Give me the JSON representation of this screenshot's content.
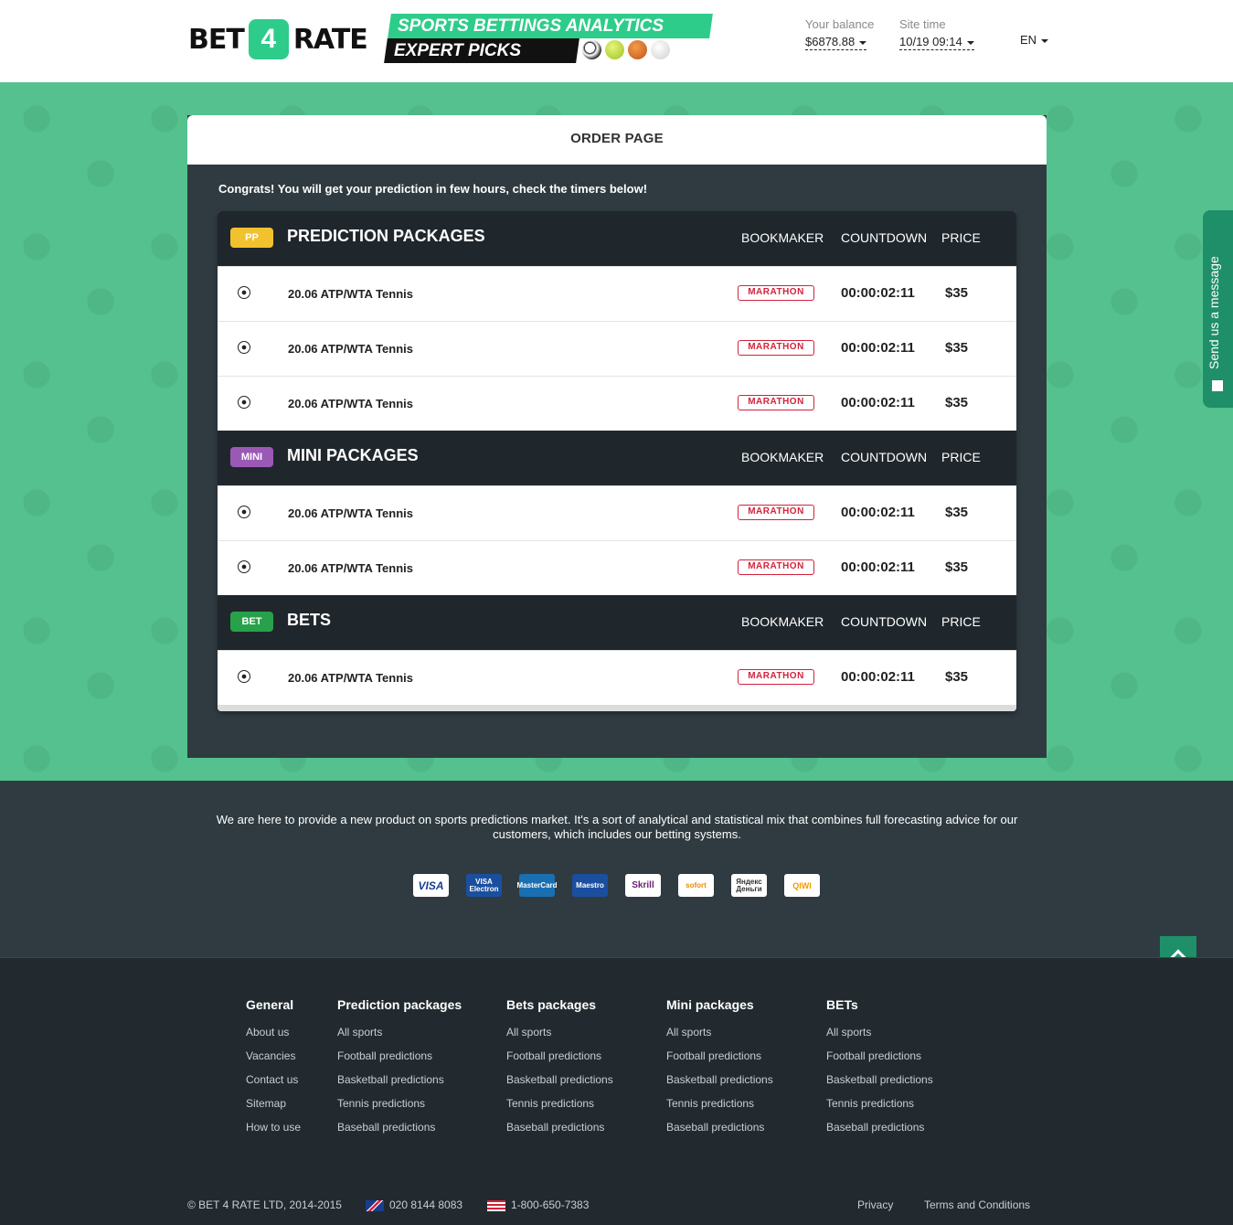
{
  "header": {
    "logo_left": "BET",
    "logo_mid": "4",
    "logo_right": "RATE",
    "tagline1": "SPORTS BETTINGS ANALYTICS",
    "tagline2": "EXPERT PICKS",
    "balance_label": "Your balance",
    "balance_value": "$6878.88",
    "time_label": "Site time",
    "time_value": "10/19 09:14",
    "lang": "EN"
  },
  "page": {
    "title": "ORDER PAGE",
    "congrats": "Congrats! You will get your prediction in few hours, check the timers below!"
  },
  "columns": {
    "bookmaker": "BOOKMAKER",
    "countdown": "COUNTDOWN",
    "price": "PRICE"
  },
  "bookmaker_logo": "MARATHON",
  "sections": [
    {
      "badge": "PP",
      "title": "PREDICTION PACKAGES",
      "rows": [
        {
          "name": "20.06 ATP/WTA Tennis",
          "countdown": "00:00:02:11",
          "price": "$35"
        },
        {
          "name": "20.06 ATP/WTA Tennis",
          "countdown": "00:00:02:11",
          "price": "$35"
        },
        {
          "name": "20.06 ATP/WTA Tennis",
          "countdown": "00:00:02:11",
          "price": "$35"
        }
      ]
    },
    {
      "badge": "MINI",
      "title": "MINI PACKAGES",
      "rows": [
        {
          "name": "20.06 ATP/WTA Tennis",
          "countdown": "00:00:02:11",
          "price": "$35"
        },
        {
          "name": "20.06 ATP/WTA Tennis",
          "countdown": "00:00:02:11",
          "price": "$35"
        }
      ]
    },
    {
      "badge": "BET",
      "title": "BETS",
      "rows": [
        {
          "name": "20.06 ATP/WTA Tennis",
          "countdown": "00:00:02:11",
          "price": "$35"
        }
      ]
    }
  ],
  "message_tab": "Send us a message",
  "footer": {
    "about": "We are here to provide a new product on sports predictions market. It's a sort of analytical and statistical mix that combines full forecasting advice for our customers, which includes our betting systems.",
    "payments": [
      "VISA",
      "VISA Electron",
      "MasterCard",
      "Maestro",
      "Skrill",
      "sofort",
      "Яндекс Деньги",
      "QIWI"
    ],
    "columns": [
      {
        "heading": "General",
        "links": [
          "About us",
          "Vacancies",
          "Contact us",
          "Sitemap",
          "How to use"
        ]
      },
      {
        "heading": "Prediction packages",
        "links": [
          "All sports",
          "Football predictions",
          "Basketball predictions",
          "Tennis predictions",
          "Baseball predictions"
        ]
      },
      {
        "heading": "Bets packages",
        "links": [
          "All sports",
          "Football predictions",
          "Basketball predictions",
          "Tennis predictions",
          "Baseball predictions"
        ]
      },
      {
        "heading": "Mini packages",
        "links": [
          "All sports",
          "Football predictions",
          "Basketball predictions",
          "Tennis predictions",
          "Baseball predictions"
        ]
      },
      {
        "heading": "BETs",
        "links": [
          "All sports",
          "Football predictions",
          "Basketball predictions",
          "Tennis predictions",
          "Baseball predictions"
        ]
      }
    ],
    "copyright": "© BET 4 RATE LTD, 2014-2015",
    "phone_uk": "020 8144 8083",
    "phone_us": "1-800-650-7383",
    "privacy": "Privacy",
    "terms": "Terms and Conditions"
  },
  "colors": {
    "accent": "#2ecc8b",
    "dark": "#20272c",
    "band": "#54c18e",
    "bookmaker": "#d2233a"
  }
}
